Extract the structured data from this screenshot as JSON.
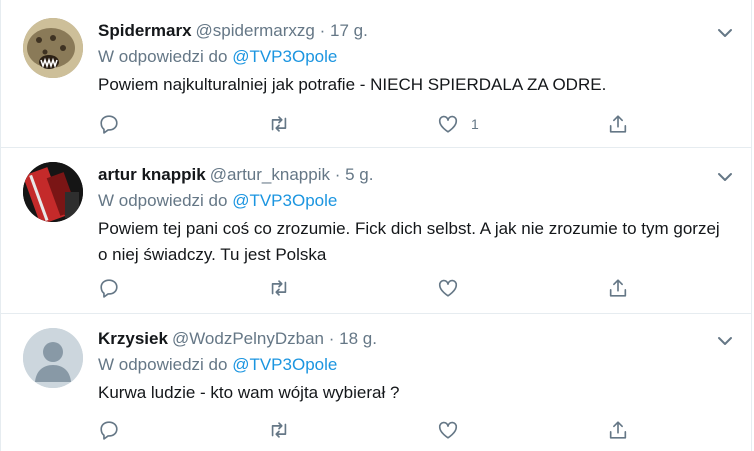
{
  "tweets": [
    {
      "name": "Spidermarx",
      "handle": "@spidermarxzg",
      "time": "17 g.",
      "reply_prefix": "W odpowiedzi do",
      "reply_to": "@TVP3Opole",
      "text": "Powiem najkulturalniej jak potrafie - NIECH SPIERDALA ZA ODRE.",
      "like_count": "1"
    },
    {
      "name": "artur knappik",
      "handle": "@artur_knappik",
      "time": "5 g.",
      "reply_prefix": "W odpowiedzi do",
      "reply_to": "@TVP3Opole",
      "text": "Powiem tej pani coś co zrozumie. Fick dich selbst. A jak nie zrozumie to tym gorzej o niej świadczy. Tu jest Polska",
      "like_count": ""
    },
    {
      "name": "Krzysiek",
      "handle": "@WodzPelnyDzban",
      "time": "18 g.",
      "reply_prefix": "W odpowiedzi do",
      "reply_to": "@TVP3Opole",
      "text": "Kurwa ludzie - kto wam wójta wybierał ?",
      "like_count": ""
    }
  ],
  "separator": "·",
  "colors": {
    "link": "#1b95e0",
    "secondary": "#657786",
    "primary": "#14171a",
    "border": "#e6ecf0",
    "icon": "#657786"
  },
  "icons": [
    "reply-icon",
    "retweet-icon",
    "like-icon",
    "share-icon",
    "chevron-down-icon"
  ]
}
